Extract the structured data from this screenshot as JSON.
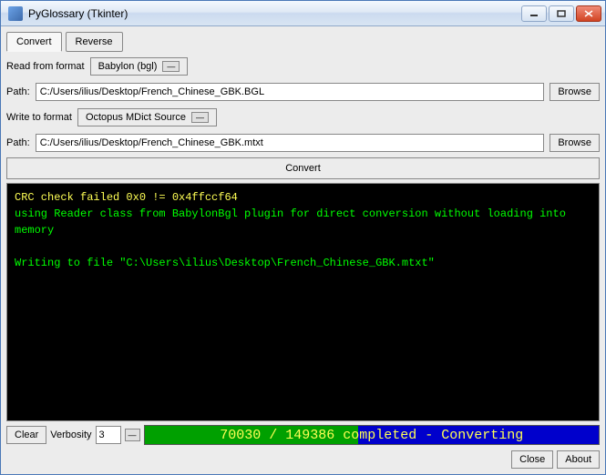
{
  "window": {
    "title": "PyGlossary (Tkinter)"
  },
  "tabs": {
    "convert": "Convert",
    "reverse": "Reverse"
  },
  "read": {
    "label": "Read from format",
    "format": "Babylon (bgl)",
    "path_label": "Path:",
    "path": "C:/Users/ilius/Desktop/French_Chinese_GBK.BGL",
    "browse": "Browse"
  },
  "write": {
    "label": "Write to format",
    "format": "Octopus MDict Source",
    "path_label": "Path:",
    "path": "C:/Users/ilius/Desktop/French_Chinese_GBK.mtxt",
    "browse": "Browse"
  },
  "buttons": {
    "convert": "Convert",
    "clear": "Clear",
    "verbosity_label": "Verbosity",
    "verbosity_value": "3",
    "close": "Close",
    "about": "About"
  },
  "console": {
    "line1": "CRC check failed 0x0 != 0x4ffccf64",
    "line2": "using Reader class from BabylonBgl plugin for direct conversion without loading into memory",
    "line3": "Writing to file \"C:\\Users\\ilius\\Desktop\\French_Chinese_GBK.mtxt\""
  },
  "progress": {
    "text": "70030 / 149386 completed - Converting",
    "percent": 47
  }
}
